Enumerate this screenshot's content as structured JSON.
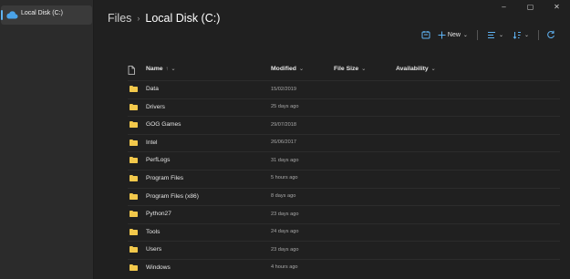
{
  "sidebar": {
    "items": [
      {
        "label": "Local Disk (C:)",
        "icon": "cloud-drive-icon",
        "selected": true
      }
    ],
    "accent_color": "#60b3f0"
  },
  "window": {
    "controls": {
      "minimize": "–",
      "maximize": "▢",
      "close": "✕"
    }
  },
  "breadcrumb": {
    "root": "Files",
    "separator": "›",
    "current": "Local Disk (C:)"
  },
  "toolbar": {
    "new_label": "New",
    "icons": [
      "open-in-terminal-icon",
      "plus-icon",
      "layout-icon",
      "sort-icon",
      "refresh-icon"
    ]
  },
  "columns": {
    "name": "Name",
    "name_sort": "↑",
    "modified": "Modified",
    "size": "File Size",
    "availability": "Availability"
  },
  "files": [
    {
      "name": "Data",
      "modified": "15/02/2019"
    },
    {
      "name": "Drivers",
      "modified": "25 days ago"
    },
    {
      "name": "GOG Games",
      "modified": "29/07/2018"
    },
    {
      "name": "Intel",
      "modified": "26/06/2017"
    },
    {
      "name": "PerfLogs",
      "modified": "31 days ago"
    },
    {
      "name": "Program Files",
      "modified": "5 hours ago"
    },
    {
      "name": "Program Files (x86)",
      "modified": "8 days ago"
    },
    {
      "name": "Python27",
      "modified": "23 days ago"
    },
    {
      "name": "Tools",
      "modified": "24 days ago"
    },
    {
      "name": "Users",
      "modified": "23 days ago"
    },
    {
      "name": "Windows",
      "modified": "4 hours ago"
    }
  ],
  "colors": {
    "folder": "#f2c84b",
    "accent": "#5fb2f2",
    "background": "#202020",
    "sidebar": "#2b2b2b"
  }
}
